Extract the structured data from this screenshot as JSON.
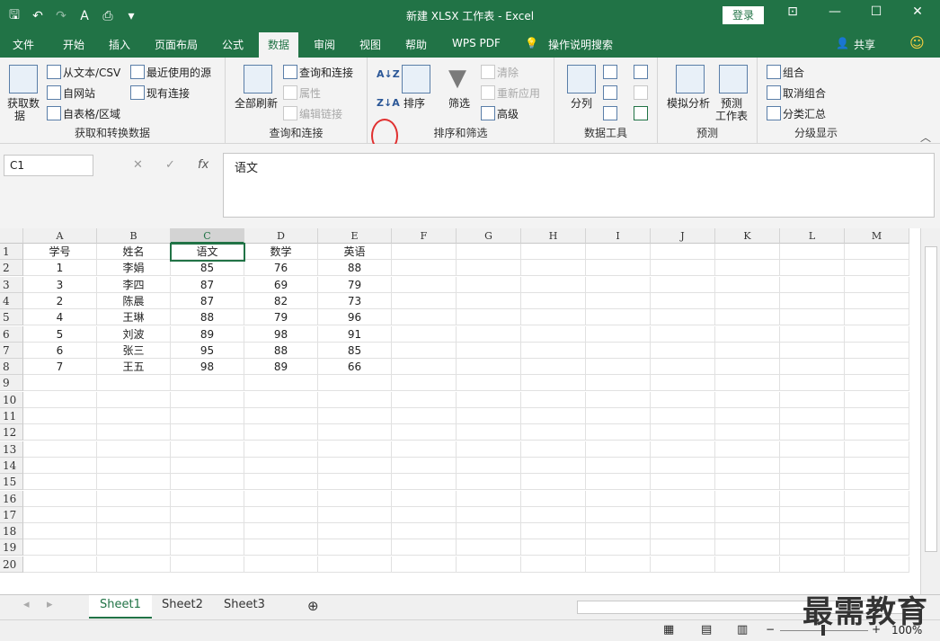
{
  "titlebar": {
    "title": "新建 XLSX 工作表 - Excel",
    "login_label": "登录",
    "save_icon": "save-icon",
    "undo_icon": "undo-icon",
    "redo_icon": "redo-icon",
    "print_icon": "print-preview-icon",
    "customize_icon": "customize-icon"
  },
  "menu": {
    "tabs": [
      "文件",
      "开始",
      "插入",
      "页面布局",
      "公式",
      "数据",
      "审阅",
      "视图",
      "帮助",
      "WPS PDF"
    ],
    "active_tab": "数据",
    "search_label": "操作说明搜索",
    "share_label": "共享"
  },
  "ribbon": {
    "get_data": {
      "label": "获取和转换数据",
      "get_data_btn_line1": "获取数",
      "get_data_btn_line2": "据",
      "from_text": "从文本/CSV",
      "from_web": "自网站",
      "from_table": "自表格/区域",
      "recent_sources": "最近使用的源",
      "existing_conn": "现有连接"
    },
    "queries": {
      "label": "查询和连接",
      "refresh_all": "全部刷新",
      "queries_conn": "查询和连接",
      "properties": "属性",
      "edit_links": "编辑链接"
    },
    "sort_filter": {
      "label": "排序和筛选",
      "sort": "排序",
      "filter": "筛选",
      "clear": "清除",
      "reapply": "重新应用",
      "advanced": "高级"
    },
    "data_tools": {
      "label": "数据工具",
      "text_to_columns": "分列"
    },
    "forecast": {
      "label": "预测",
      "what_if": "模拟分析",
      "forecast_sheet_line1": "预测",
      "forecast_sheet_line2": "工作表"
    },
    "outline": {
      "label": "分级显示",
      "group": "组合",
      "ungroup": "取消组合",
      "subtotal": "分类汇总"
    }
  },
  "formula_bar": {
    "name_box": "C1",
    "content": "语文",
    "fx_label": "fx"
  },
  "sheet": {
    "columns": [
      "A",
      "B",
      "C",
      "D",
      "E",
      "F",
      "G",
      "H",
      "I",
      "J",
      "K",
      "L",
      "M"
    ],
    "selected_column": "C",
    "header_row": [
      "学号",
      "姓名",
      "语文",
      "数学",
      "英语"
    ],
    "rows": [
      [
        "1",
        "李娟",
        "85",
        "76",
        "88"
      ],
      [
        "3",
        "李四",
        "87",
        "69",
        "79"
      ],
      [
        "2",
        "陈晨",
        "87",
        "82",
        "73"
      ],
      [
        "4",
        "王琳",
        "88",
        "79",
        "96"
      ],
      [
        "5",
        "刘波",
        "89",
        "98",
        "91"
      ],
      [
        "6",
        "张三",
        "95",
        "88",
        "85"
      ],
      [
        "7",
        "王五",
        "98",
        "89",
        "66"
      ]
    ],
    "row_numbers": [
      "1",
      "2",
      "3",
      "4",
      "5",
      "6",
      "7",
      "8",
      "9",
      "10",
      "11",
      "12",
      "13",
      "14",
      "15",
      "16",
      "17",
      "18",
      "19",
      "20"
    ]
  },
  "sheet_tabs": [
    "Sheet1",
    "Sheet2",
    "Sheet3"
  ],
  "active_sheet": "Sheet1",
  "status": {
    "zoom": "100%"
  },
  "watermark": "最需教育",
  "colors": {
    "excel_green": "#217346",
    "highlight_circle": "#e03030"
  }
}
